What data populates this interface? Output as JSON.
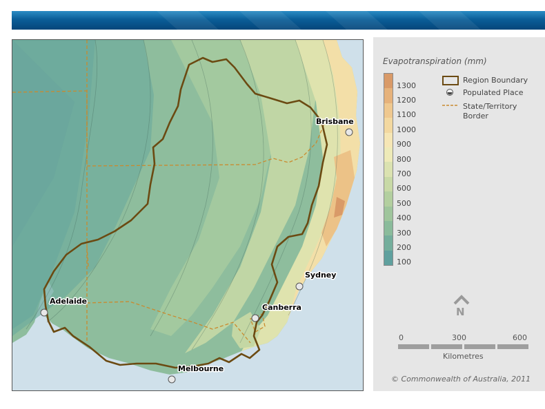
{
  "legend": {
    "title": "Evapotranspiration (mm)",
    "ramp": [
      {
        "label": "1300",
        "color": "#d99a68"
      },
      {
        "label": "1200",
        "color": "#e6b27b"
      },
      {
        "label": "1100",
        "color": "#efc88f"
      },
      {
        "label": "1000",
        "color": "#f3d8a0"
      },
      {
        "label": "900",
        "color": "#f6e6b5"
      },
      {
        "label": "800",
        "color": "#eeeab8"
      },
      {
        "label": "700",
        "color": "#dbe2b0"
      },
      {
        "label": "600",
        "color": "#c8d9a6"
      },
      {
        "label": "500",
        "color": "#b3cf9f"
      },
      {
        "label": "400",
        "color": "#9fc59c"
      },
      {
        "label": "300",
        "color": "#8abb9b"
      },
      {
        "label": "200",
        "color": "#74ae9c"
      },
      {
        "label": "100",
        "color": "#5fa09e"
      }
    ],
    "symbols": {
      "region_boundary": "Region Boundary",
      "populated_place": "Populated Place",
      "state_border": "State/Territory Border"
    }
  },
  "north_arrow": {
    "label": "N"
  },
  "scale_bar": {
    "ticks": [
      "0",
      "300",
      "600"
    ],
    "units": "Kilometres"
  },
  "copyright": "© Commonwealth of Australia, 2011",
  "cities": [
    {
      "name": "Brisbane"
    },
    {
      "name": "Sydney"
    },
    {
      "name": "Canberra"
    },
    {
      "name": "Adelaide"
    },
    {
      "name": "Melbourne"
    }
  ],
  "colors": {
    "ocean": "#cfe0ea",
    "region_boundary": "#6b4a12",
    "state_border": "#c98a2e",
    "banner": "#0a5e98"
  }
}
